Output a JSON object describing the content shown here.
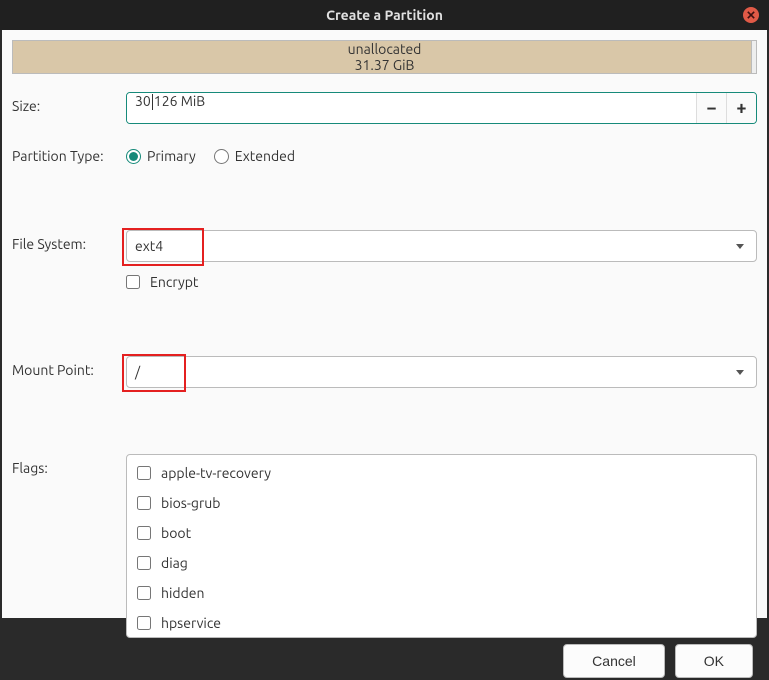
{
  "window": {
    "title": "Create a Partition"
  },
  "partition_bar": {
    "name": "unallocated",
    "size": "31.37 GiB"
  },
  "form": {
    "size_label": "Size:",
    "size_value_a": "30",
    "size_value_b": "126 MiB",
    "partition_type_label": "Partition Type:",
    "primary_label": "Primary",
    "extended_label": "Extended",
    "filesystem_label": "File System:",
    "filesystem_value": "ext4",
    "encrypt_label": "Encrypt",
    "mountpoint_label": "Mount Point:",
    "mountpoint_value": "/",
    "flags_label": "Flags:"
  },
  "flags": [
    "apple-tv-recovery",
    "bios-grub",
    "boot",
    "diag",
    "hidden",
    "hpservice"
  ],
  "buttons": {
    "cancel": "Cancel",
    "ok": "OK"
  }
}
